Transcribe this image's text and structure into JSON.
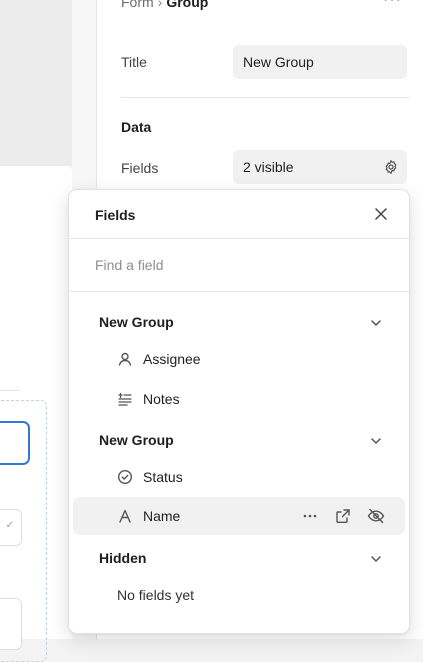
{
  "panel": {
    "breadcrumb": {
      "parent": "Form",
      "separator": "›",
      "current": "Group"
    },
    "more_icon": "more-horizontal-icon",
    "title_label": "Title",
    "title_value": "New Group",
    "section_title": "Data",
    "fields_label": "Fields",
    "fields_value": "2 visible",
    "fields_icon": "gear-icon"
  },
  "popover": {
    "title": "Fields",
    "close_icon": "close-icon",
    "search_placeholder": "Find a field",
    "groups": [
      {
        "name": "New Group",
        "chevron_icon": "chevron-down-icon",
        "fields": [
          {
            "label": "Assignee",
            "icon": "person-icon"
          },
          {
            "label": "Notes",
            "icon": "long-text-icon"
          }
        ]
      },
      {
        "name": "New Group",
        "chevron_icon": "chevron-down-icon",
        "fields": [
          {
            "label": "Status",
            "icon": "status-check-icon"
          },
          {
            "label": "Name",
            "icon": "text-field-icon",
            "hovered": true,
            "actions": [
              "more-horizontal-icon",
              "open-external-icon",
              "eye-off-icon"
            ]
          }
        ]
      },
      {
        "name": "Hidden",
        "chevron_icon": "chevron-down-icon",
        "empty_text": "No fields yet"
      }
    ]
  },
  "colors": {
    "selection_outline": "#2f78d6",
    "hover_row": "#f1f1f1",
    "input_bg": "#f1f1f1"
  }
}
